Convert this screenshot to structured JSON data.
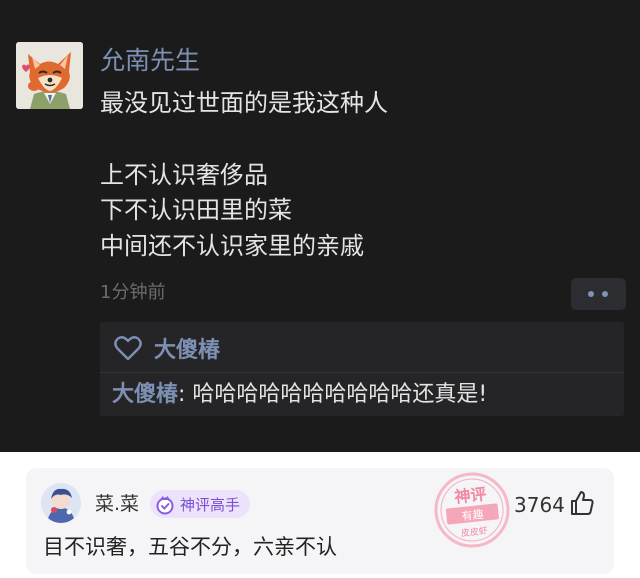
{
  "post": {
    "author": "允南先生",
    "lines": [
      "最没见过世面的是我这种人",
      "上不认识奢侈品",
      "下不认识田里的菜",
      "中间还不认识家里的亲戚"
    ],
    "time": "1分钟前",
    "likes": {
      "icon": "heart-outline-icon",
      "names": "大傻椿"
    },
    "comment": {
      "user": "大傻椿",
      "separator": ": ",
      "text": "哈哈哈哈哈哈哈哈哈哈还真是!"
    }
  },
  "card": {
    "username": "菜.菜",
    "badge": {
      "icon": "crown-medal-icon",
      "label": "神评高手"
    },
    "stamp": {
      "top": "神评",
      "middle": "有趣",
      "bottom": "皮皮虾"
    },
    "like_count": "3764",
    "like_icon": "thumbs-up-icon",
    "comment": "目不识奢，五谷不分，六亲不认"
  },
  "colors": {
    "post_background": "#1b1b1c",
    "name_blue": "#7d90b3",
    "stamp_pink": "#f28fa6",
    "badge_purple": "#7a4ed8"
  }
}
